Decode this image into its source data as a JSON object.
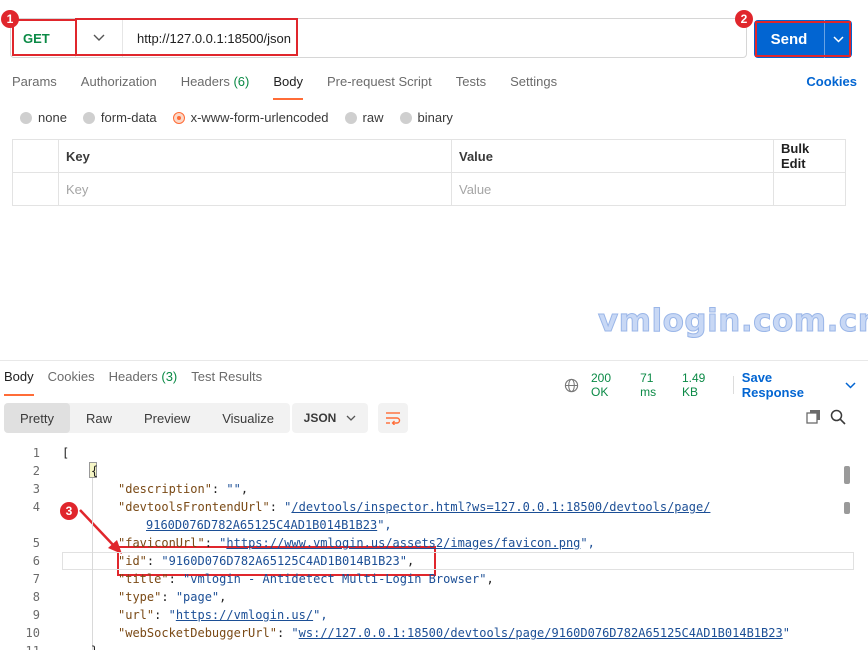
{
  "request": {
    "method": "GET",
    "url": "http://127.0.0.1:18500/json",
    "send_label": "Send"
  },
  "request_tabs": [
    {
      "label": "Params"
    },
    {
      "label": "Authorization"
    },
    {
      "label": "Headers",
      "count": "(6)"
    },
    {
      "label": "Body",
      "active": true
    },
    {
      "label": "Pre-request Script"
    },
    {
      "label": "Tests"
    },
    {
      "label": "Settings"
    }
  ],
  "cookies_label": "Cookies",
  "body_types": [
    "none",
    "form-data",
    "x-www-form-urlencoded",
    "raw",
    "binary"
  ],
  "body_type_selected": "x-www-form-urlencoded",
  "kv_table": {
    "headers": {
      "key": "Key",
      "value": "Value",
      "bulk": "Bulk Edit"
    },
    "placeholders": {
      "key": "Key",
      "value": "Value"
    }
  },
  "watermark": "vmlogin.com.cn",
  "annotations": [
    "1",
    "2",
    "3"
  ],
  "response": {
    "tabs": [
      {
        "label": "Body",
        "active": true
      },
      {
        "label": "Cookies"
      },
      {
        "label": "Headers",
        "count": "(3)"
      },
      {
        "label": "Test Results"
      }
    ],
    "status": "200 OK",
    "time": "71 ms",
    "size": "1.49 KB",
    "save_label": "Save Response",
    "view_tabs": [
      "Pretty",
      "Raw",
      "Preview",
      "Visualize"
    ],
    "format": "JSON",
    "code_lines": [
      {
        "n": "1",
        "text": "["
      },
      {
        "n": "2",
        "text": "    {"
      },
      {
        "n": "3",
        "key": "\"description\"",
        "val": "\"\"",
        "tail": ","
      },
      {
        "n": "4",
        "key": "\"devtoolsFrontendUrl\"",
        "link": "/devtools/inspector.html?ws=127.0.0.1:18500/devtools/page/",
        "cont": "9160D076D782A65125C4AD1B014B1B23",
        "tail": "\","
      },
      {
        "n": "5",
        "key": "\"faviconUrl\"",
        "link": "https://www.vmlogin.us/assets2/images/favicon.png",
        "tail": "\","
      },
      {
        "n": "6",
        "key": "\"id\"",
        "val": "\"9160D076D782A65125C4AD1B014B1B23\"",
        "tail": ","
      },
      {
        "n": "7",
        "key": "\"title\"",
        "val": "\"vmlogin - Antidetect Multi-Login Browser\"",
        "tail": ","
      },
      {
        "n": "8",
        "key": "\"type\"",
        "val": "\"page\"",
        "tail": ","
      },
      {
        "n": "9",
        "key": "\"url\"",
        "link": "https://vmlogin.us/",
        "tail": "\","
      },
      {
        "n": "10",
        "key": "\"webSocketDebuggerUrl\"",
        "link": "ws://127.0.0.1:18500/devtools/page/9160D076D782A65125C4AD1B014B1B23",
        "tail": "\""
      },
      {
        "n": "11",
        "text": "    }"
      }
    ]
  },
  "colors": {
    "accent": "#ff6c37",
    "send": "#0265d2",
    "annotation": "#e0262c",
    "status_ok": "#0b8a46"
  }
}
